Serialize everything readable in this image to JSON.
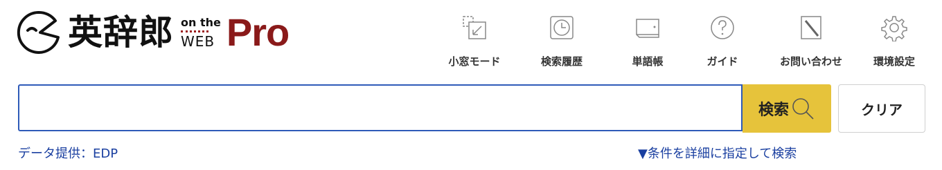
{
  "logo": {
    "jp_text": "英辞郎",
    "on_the": "on the",
    "web": "WEB",
    "pro": "Pro",
    "pro_color": "#8a1a1a"
  },
  "toolbar": {
    "items": [
      {
        "label": "小窓モード",
        "icon": "mini-window-icon"
      },
      {
        "label": "検索履歴",
        "icon": "clock-icon"
      },
      {
        "label": "単語帳",
        "icon": "wordbook-icon"
      },
      {
        "label": "ガイド",
        "icon": "help-icon"
      },
      {
        "label": "お問い合わせ",
        "icon": "pen-icon"
      },
      {
        "label": "環境設定",
        "icon": "gear-icon"
      }
    ]
  },
  "search": {
    "value": "",
    "placeholder": "",
    "button_label": "検索",
    "button_color": "#e6c33b",
    "clear_label": "クリア"
  },
  "footer": {
    "data_source": "データ提供：EDP",
    "advanced_link": "▼条件を詳細に指定して検索",
    "link_color": "#1a3fa0"
  }
}
